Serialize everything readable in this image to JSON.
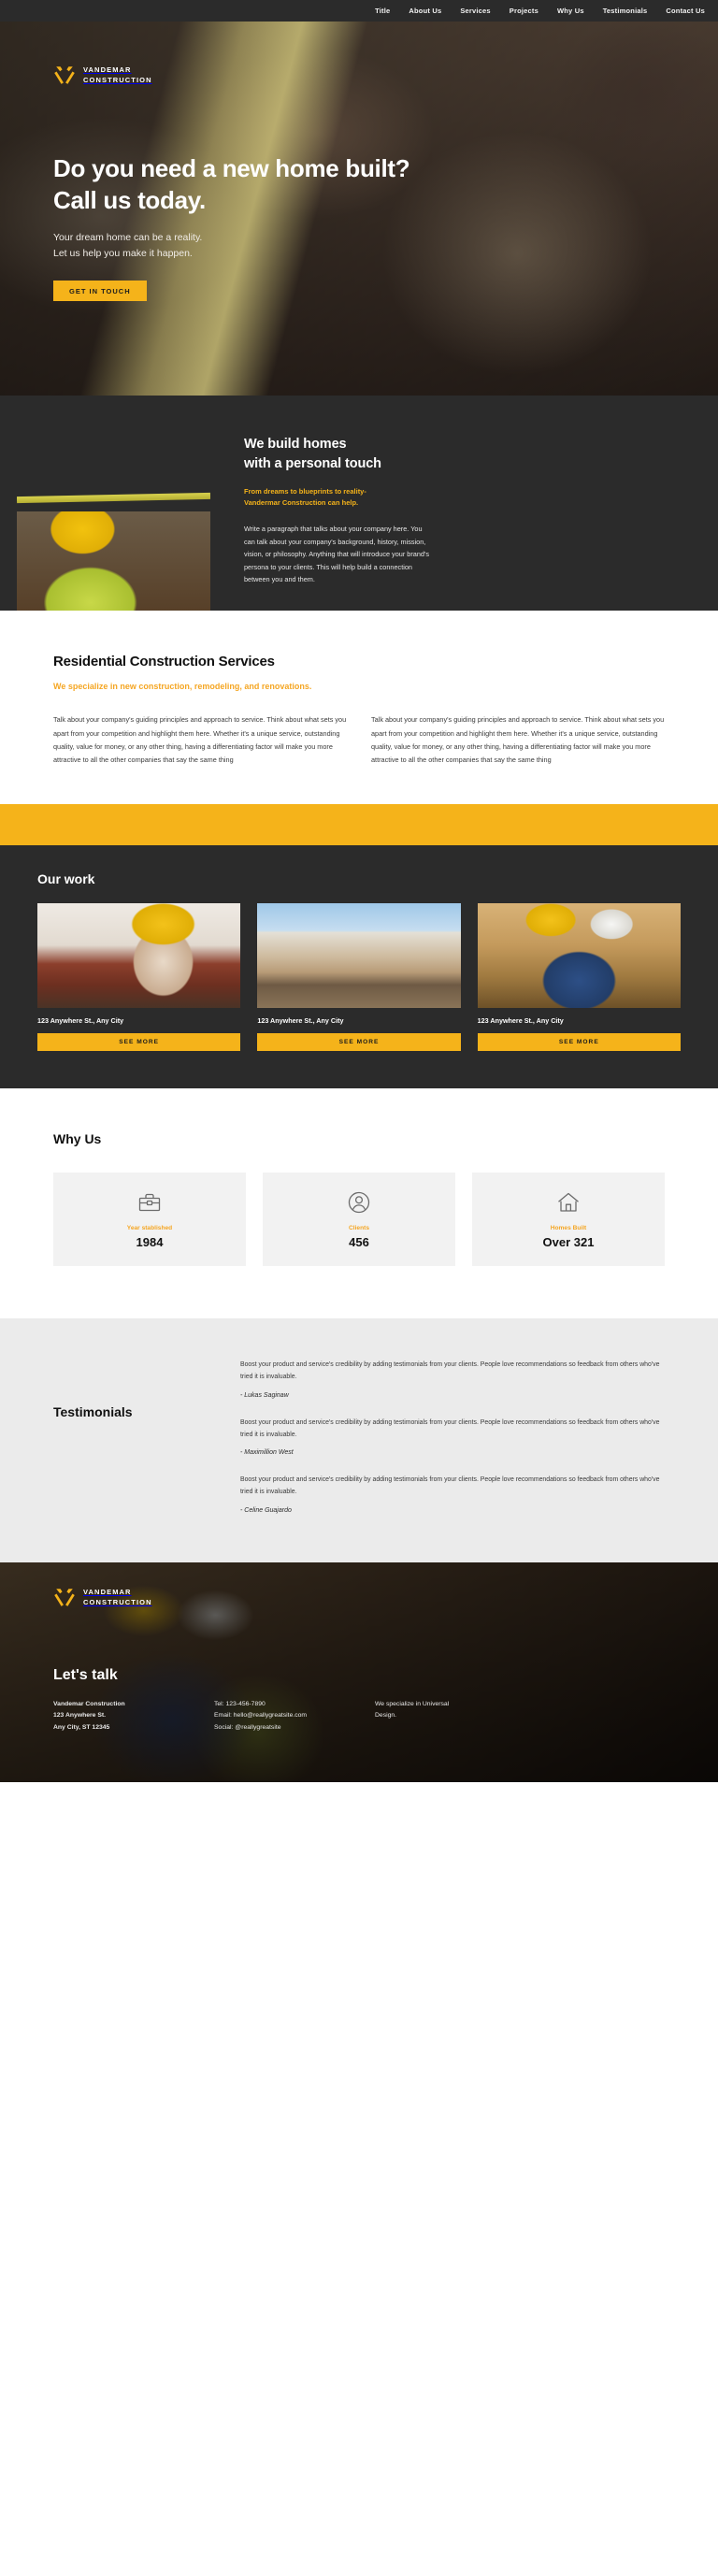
{
  "nav": {
    "items": [
      {
        "label": "Title"
      },
      {
        "label": "About Us"
      },
      {
        "label": "Services"
      },
      {
        "label": "Projects"
      },
      {
        "label": "Why Us"
      },
      {
        "label": "Testimonials"
      },
      {
        "label": "Contact Us"
      }
    ]
  },
  "brand": {
    "line1": "VANDEMAR",
    "line2": "CONSTRUCTION",
    "icon": "crossed-hammers-icon",
    "accent_color": "#f5b31a"
  },
  "hero": {
    "title_line1": "Do you need a new home built?",
    "title_line2": "Call us today.",
    "sub_line1": "Your dream home can be a reality.",
    "sub_line2": "Let us help you make it happen.",
    "cta_label": "GET IN TOUCH"
  },
  "about": {
    "heading_line1": "We build homes",
    "heading_line2": "with a personal touch",
    "kicker_line1": "From dreams to blueprints to reality-",
    "kicker_line2": "Vandermar Construction can help.",
    "body": "Write a paragraph that talks about your company here. You can talk about your company's background, history, mission, vision, or philosophy. Anything that will introduce your brand's persona to your clients. This will help build a connection between you and them."
  },
  "services": {
    "title": "Residential Construction Services",
    "kicker": "We specialize in new construction, remodeling, and renovations.",
    "paragraph1": "Talk about your company's guiding principles and approach to service. Think about what sets you apart from your competition and highlight them here. Whether it's a unique service, outstanding quality, value for money, or any other thing, having a differentiating factor will make you more attractive to all the other companies that say the same thing",
    "paragraph2": "Talk about your company's guiding principles and approach to service. Think about what sets you apart from your competition and highlight them here. Whether it's a unique service, outstanding quality, value for money, or any other thing, having a differentiating factor will make you more attractive to all the other companies that say the same thing"
  },
  "work": {
    "title": "Our work",
    "cards": [
      {
        "address": "123 Anywhere St., Any City",
        "button": "SEE MORE"
      },
      {
        "address": "123 Anywhere St., Any City",
        "button": "SEE MORE"
      },
      {
        "address": "123 Anywhere St., Any City",
        "button": "SEE MORE"
      }
    ]
  },
  "why_us": {
    "title": "Why Us",
    "stats": [
      {
        "icon": "toolbox-icon",
        "label": "Year stablished",
        "value": "1984"
      },
      {
        "icon": "user-circle-icon",
        "label": "Clients",
        "value": "456"
      },
      {
        "icon": "home-icon",
        "label": "Homes Built",
        "value": "Over 321"
      }
    ]
  },
  "testimonials": {
    "title": "Testimonials",
    "items": [
      {
        "quote": "Boost your product and service's credibility by adding testimonials from your clients. People love recommendations so feedback from others who've tried it is invaluable.",
        "author": "- Lukas Saginaw"
      },
      {
        "quote": "Boost your product and service's credibility by adding testimonials from your clients. People love recommendations so feedback from others who've tried it is invaluable.",
        "author": "- Maximillion West"
      },
      {
        "quote": "Boost your product and service's credibility by adding testimonials from your clients. People love recommendations so feedback from others who've tried it is invaluable.",
        "author": "- Celine Guajardo"
      }
    ]
  },
  "footer": {
    "heading": "Let's talk",
    "company": "Vandemar Construction",
    "address_line1": "123 Anywhere St.",
    "address_line2": "Any City, ST 12345",
    "tel": "Tel: 123-456-7890",
    "email": "Email: hello@reallygreatsite.com",
    "social": "Social: @reallygreatsite",
    "note_line1": "We specialize in Universal",
    "note_line2": "Design."
  }
}
